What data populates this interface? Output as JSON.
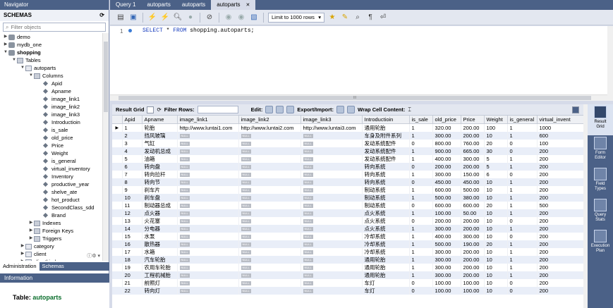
{
  "navigator": {
    "header": "Navigator",
    "schemas_title": "SCHEMAS",
    "filter_placeholder": "Filter objects",
    "tree": [
      {
        "label": "demo",
        "level": 0,
        "type": "db",
        "twisty": "▶",
        "bold": false
      },
      {
        "label": "mydb_one",
        "level": 0,
        "type": "db",
        "twisty": "▶",
        "bold": false
      },
      {
        "label": "shopping",
        "level": 0,
        "type": "db",
        "twisty": "▼",
        "bold": true
      },
      {
        "label": "Tables",
        "level": 1,
        "type": "folder",
        "twisty": "▼",
        "bold": false
      },
      {
        "label": "autoparts",
        "level": 2,
        "type": "table",
        "twisty": "▼",
        "bold": false
      },
      {
        "label": "Columns",
        "level": 3,
        "type": "folder",
        "twisty": "▼",
        "bold": false
      },
      {
        "label": "Apid",
        "level": 4,
        "type": "col",
        "twisty": "",
        "bold": false
      },
      {
        "label": "Apname",
        "level": 4,
        "type": "col",
        "twisty": "",
        "bold": false
      },
      {
        "label": "image_link1",
        "level": 4,
        "type": "col",
        "twisty": "",
        "bold": false
      },
      {
        "label": "image_link2",
        "level": 4,
        "type": "col",
        "twisty": "",
        "bold": false
      },
      {
        "label": "image_link3",
        "level": 4,
        "type": "col",
        "twisty": "",
        "bold": false
      },
      {
        "label": "Introductioin",
        "level": 4,
        "type": "col",
        "twisty": "",
        "bold": false
      },
      {
        "label": "is_sale",
        "level": 4,
        "type": "col",
        "twisty": "",
        "bold": false
      },
      {
        "label": "old_price",
        "level": 4,
        "type": "col",
        "twisty": "",
        "bold": false
      },
      {
        "label": "Price",
        "level": 4,
        "type": "col",
        "twisty": "",
        "bold": false
      },
      {
        "label": "Weight",
        "level": 4,
        "type": "col",
        "twisty": "",
        "bold": false
      },
      {
        "label": "is_general",
        "level": 4,
        "type": "col",
        "twisty": "",
        "bold": false
      },
      {
        "label": "virtual_inventory",
        "level": 4,
        "type": "col",
        "twisty": "",
        "bold": false
      },
      {
        "label": "Inventory",
        "level": 4,
        "type": "col",
        "twisty": "",
        "bold": false
      },
      {
        "label": "productive_year",
        "level": 4,
        "type": "col",
        "twisty": "",
        "bold": false
      },
      {
        "label": "shelve_ate",
        "level": 4,
        "type": "col",
        "twisty": "",
        "bold": false
      },
      {
        "label": "hot_product",
        "level": 4,
        "type": "col",
        "twisty": "",
        "bold": false
      },
      {
        "label": "SecondClass_sdd",
        "level": 4,
        "type": "col",
        "twisty": "",
        "bold": false
      },
      {
        "label": "Brand",
        "level": 4,
        "type": "col",
        "twisty": "",
        "bold": false
      },
      {
        "label": "Indexes",
        "level": 3,
        "type": "folder",
        "twisty": "▶",
        "bold": false
      },
      {
        "label": "Foreign Keys",
        "level": 3,
        "type": "folder",
        "twisty": "▶",
        "bold": false
      },
      {
        "label": "Triggers",
        "level": 3,
        "type": "folder",
        "twisty": "▶",
        "bold": false
      },
      {
        "label": "category",
        "level": 2,
        "type": "table",
        "twisty": "▶",
        "bold": false
      },
      {
        "label": "client",
        "level": 2,
        "type": "table",
        "twisty": "▶",
        "bold": false
      },
      {
        "label": "clientkind",
        "level": 2,
        "type": "table",
        "twisty": "▶",
        "bold": false
      }
    ],
    "tabs": [
      "Administration",
      "Schemas"
    ],
    "info_header": "Information",
    "info_label": "Table:",
    "info_table": "autoparts"
  },
  "editor": {
    "tabs": [
      "Query 1",
      "autoparts",
      "autoparts",
      "autoparts"
    ],
    "limit": "Limit to 1000 rows",
    "line_no": "1",
    "sql_keyword1": "SELECT",
    "sql_star": " * ",
    "sql_keyword2": "FROM",
    "sql_rest": " shopping.autoparts;"
  },
  "result_toolbar": {
    "result_grid": "Result Grid",
    "filter_rows": "Filter Rows:",
    "edit": "Edit:",
    "export_import": "Export/Import:",
    "wrap": "Wrap Cell Content:"
  },
  "side_panel": [
    {
      "label": "Result\nGrid",
      "active": true
    },
    {
      "label": "Form\nEditor",
      "active": false
    },
    {
      "label": "Field\nTypes",
      "active": false
    },
    {
      "label": "Query\nStats",
      "active": false
    },
    {
      "label": "Execution\nPlan",
      "active": false
    }
  ],
  "grid": {
    "columns": [
      "Apid",
      "Apname",
      "image_link1",
      "image_link2",
      "image_link3",
      "Introductioin",
      "is_sale",
      "old_price",
      "Price",
      "Weight",
      "is_general",
      "virtual_invent"
    ],
    "null_label": "NULL",
    "rows": [
      [
        "1",
        "轮胎",
        "http://www.luntai1.com",
        "http://www.luntai2.com",
        "http://www.luntai3.com",
        "通用轮胎",
        "1",
        "320.00",
        "200.00",
        "100",
        "1",
        "1000"
      ],
      [
        "2",
        "挡风玻璃",
        null,
        null,
        null,
        "车身及附件系列",
        "1",
        "300.00",
        "200.00",
        "10",
        "1",
        "600"
      ],
      [
        "3",
        "气缸",
        null,
        null,
        null,
        "发动系统配件",
        "0",
        "800.00",
        "760.00",
        "20",
        "0",
        "100"
      ],
      [
        "4",
        "发动机总成",
        null,
        null,
        null,
        "发动系统配件",
        "1",
        "900.00",
        "665.00",
        "30",
        "0",
        "200"
      ],
      [
        "5",
        "油箱",
        null,
        null,
        null,
        "发动系统配件",
        "1",
        "400.00",
        "300.00",
        "5",
        "1",
        "200"
      ],
      [
        "6",
        "转向盘",
        null,
        null,
        null,
        "转向系统",
        "0",
        "200.00",
        "200.00",
        "5",
        "1",
        "200"
      ],
      [
        "7",
        "转向拉杆",
        null,
        null,
        null,
        "转向系统",
        "1",
        "300.00",
        "150.00",
        "6",
        "0",
        "200"
      ],
      [
        "8",
        "转向节",
        null,
        null,
        null,
        "转向系统",
        "0",
        "450.00",
        "450.00",
        "10",
        "1",
        "200"
      ],
      [
        "9",
        "刹车片",
        null,
        null,
        null,
        "制动系统",
        "1",
        "600.00",
        "500.00",
        "10",
        "1",
        "200"
      ],
      [
        "10",
        "刹车盘",
        null,
        null,
        null,
        "制动系统",
        "1",
        "500.00",
        "380.00",
        "10",
        "1",
        "200"
      ],
      [
        "11",
        "制动器总成",
        null,
        null,
        null,
        "制动系统",
        "0",
        "600.00",
        "600.00",
        "20",
        "1",
        "500"
      ],
      [
        "12",
        "点火器",
        null,
        null,
        null,
        "点火系统",
        "1",
        "100.00",
        "50.00",
        "10",
        "1",
        "200"
      ],
      [
        "13",
        "火花塞",
        null,
        null,
        null,
        "点火系统",
        "0",
        "200.00",
        "200.00",
        "10",
        "0",
        "200"
      ],
      [
        "14",
        "分电器",
        null,
        null,
        null,
        "点火系统",
        "1",
        "300.00",
        "200.00",
        "10",
        "1",
        "200"
      ],
      [
        "15",
        "水泵",
        null,
        null,
        null,
        "冷却系统",
        "1",
        "400.00",
        "300.00",
        "10",
        "0",
        "200"
      ],
      [
        "16",
        "散热器",
        null,
        null,
        null,
        "冷却系统",
        "1",
        "500.00",
        "190.00",
        "20",
        "1",
        "200"
      ],
      [
        "17",
        "水箱",
        null,
        null,
        null,
        "冷却系统",
        "1",
        "300.00",
        "200.00",
        "10",
        "1",
        "200"
      ],
      [
        "18",
        "汽车轮胎",
        null,
        null,
        null,
        "通用轮胎",
        "1",
        "300.00",
        "200.00",
        "10",
        "1",
        "200"
      ],
      [
        "19",
        "农用车轮胎",
        null,
        null,
        null,
        "通用轮胎",
        "1",
        "300.00",
        "200.00",
        "10",
        "1",
        "200"
      ],
      [
        "20",
        "工程机械胎",
        null,
        null,
        null,
        "通用轮胎",
        "1",
        "300.00",
        "200.00",
        "10",
        "1",
        "200"
      ],
      [
        "21",
        "前照灯",
        null,
        null,
        null,
        "车灯",
        "0",
        "100.00",
        "100.00",
        "10",
        "0",
        "200"
      ],
      [
        "22",
        "转向灯",
        null,
        null,
        null,
        "车灯",
        "0",
        "100.00",
        "100.00",
        "10",
        "0",
        "200"
      ]
    ]
  }
}
